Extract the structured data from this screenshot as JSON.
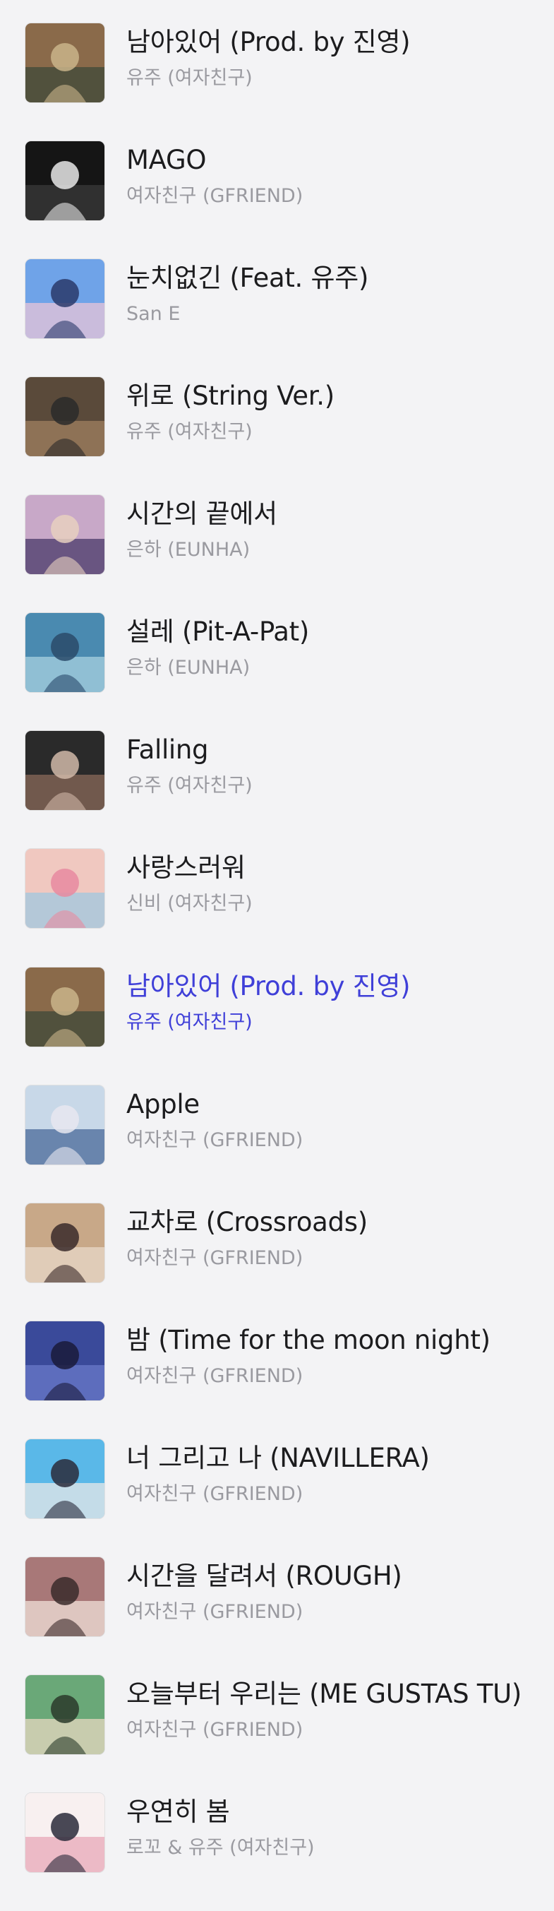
{
  "tracks": [
    {
      "title": "남아있어 (Prod. by 진영)",
      "artist": "유주 (여자친구)",
      "cover": "cover-art-icon",
      "palette": [
        "#8a6a4a",
        "#3d4a3a",
        "#c9b48a"
      ]
    },
    {
      "title": "MAGO",
      "artist": "여자친구 (GFRIEND)",
      "cover": "cover-art-icon",
      "palette": [
        "#151515",
        "#3a3a3a",
        "#e8e8e8"
      ]
    },
    {
      "title": "눈치없긴 (Feat. 유주)",
      "artist": "San E",
      "cover": "cover-art-icon",
      "palette": [
        "#6fa3e8",
        "#e8c4d8",
        "#2a3a6a"
      ]
    },
    {
      "title": "위로 (String Ver.)",
      "artist": "유주 (여자친구)",
      "cover": "cover-art-icon",
      "palette": [
        "#5a4a3a",
        "#a08060",
        "#2a2a2a"
      ]
    },
    {
      "title": "시간의 끝에서",
      "artist": "은하 (EUNHA)",
      "cover": "cover-art-icon",
      "palette": [
        "#c8a8c8",
        "#4a3a6a",
        "#e8d0c0"
      ]
    },
    {
      "title": "설레 (Pit-A-Pat)",
      "artist": "은하 (EUNHA)",
      "cover": "cover-art-icon",
      "palette": [
        "#4a8ab0",
        "#a8d0e0",
        "#2a4a6a"
      ]
    },
    {
      "title": "Falling",
      "artist": "유주 (여자친구)",
      "cover": "cover-art-icon",
      "palette": [
        "#2a2a2a",
        "#8a6a5a",
        "#d0b8a8"
      ]
    },
    {
      "title": "사랑스러워",
      "artist": "신비 (여자친구)",
      "cover": "cover-art-icon",
      "palette": [
        "#f0c8c0",
        "#a0c8e0",
        "#e88aa0"
      ]
    },
    {
      "title": "남아있어 (Prod. by 진영)",
      "artist": "유주 (여자친구)",
      "cover": "cover-art-icon",
      "palette": [
        "#8a6a4a",
        "#3d4a3a",
        "#c9b48a"
      ]
    },
    {
      "title": "Apple",
      "artist": "여자친구 (GFRIEND)",
      "cover": "cover-art-icon",
      "palette": [
        "#c8d8e8",
        "#4a6a9a",
        "#e8e8f0"
      ]
    },
    {
      "title": "교차로 (Crossroads)",
      "artist": "여자친구 (GFRIEND)",
      "cover": "cover-art-icon",
      "palette": [
        "#c8a888",
        "#e8d8c8",
        "#3a2a2a"
      ]
    },
    {
      "title": "밤 (Time for the moon night)",
      "artist": "여자친구 (GFRIEND)",
      "cover": "cover-art-icon",
      "palette": [
        "#3a4a9a",
        "#6a7ac8",
        "#1a1a3a"
      ]
    },
    {
      "title": "너 그리고 나 (NAVILLERA)",
      "artist": "여자친구 (GFRIEND)",
      "cover": "cover-art-icon",
      "palette": [
        "#5ab8e8",
        "#e8e8e8",
        "#2a2a3a"
      ]
    },
    {
      "title": "시간을 달려서 (ROUGH)",
      "artist": "여자친구 (GFRIEND)",
      "cover": "cover-art-icon",
      "palette": [
        "#a87878",
        "#f0e0d8",
        "#3a2a2a"
      ]
    },
    {
      "title": "오늘부터 우리는 (ME GUSTAS TU)",
      "artist": "여자친구 (GFRIEND)",
      "cover": "cover-art-icon",
      "palette": [
        "#6aa878",
        "#e8d8c0",
        "#2a3a2a"
      ]
    },
    {
      "title": "우연히 봄",
      "artist": "로꼬 & 유주 (여자친구)",
      "cover": "cover-art-icon",
      "palette": [
        "#f8f0f0",
        "#e8a8b8",
        "#2a2a3a"
      ]
    }
  ],
  "active_index": 8,
  "colors": {
    "background": "#f3f3f5",
    "title": "#1c1c1e",
    "artist": "#9a9aa0",
    "active": "#3f3fd8"
  }
}
